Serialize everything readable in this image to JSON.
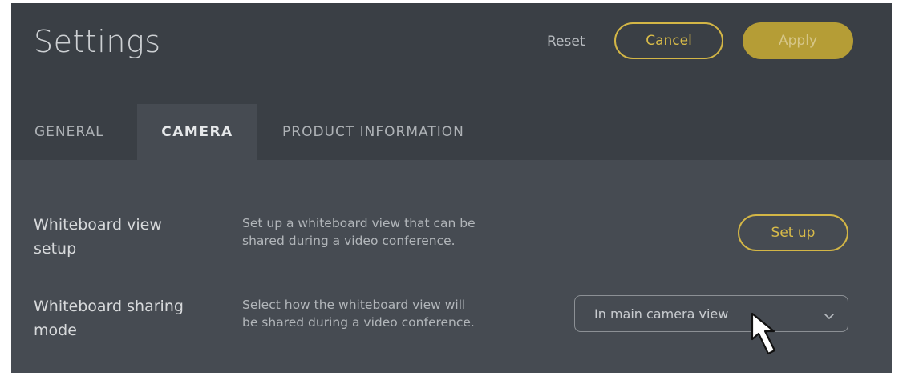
{
  "header": {
    "title": "Settings",
    "reset_label": "Reset",
    "cancel_label": "Cancel",
    "apply_label": "Apply"
  },
  "tabs": [
    {
      "label": "GENERAL",
      "active": false
    },
    {
      "label": "CAMERA",
      "active": true
    },
    {
      "label": "PRODUCT INFORMATION",
      "active": false
    }
  ],
  "settings": {
    "whiteboard_setup": {
      "title_line1": "Whiteboard view",
      "title_line2": "setup",
      "desc_line1": "Set up a whiteboard view that can be",
      "desc_line2": "shared during a video conference.",
      "button_label": "Set up"
    },
    "whiteboard_sharing": {
      "title_line1": "Whiteboard sharing",
      "title_line2": "mode",
      "desc_line1": "Select how the whiteboard view will",
      "desc_line2": "be shared during a video conference.",
      "selected_value": "In main camera view"
    }
  },
  "colors": {
    "header_bg": "#3a3f45",
    "panel_bg": "#464b52",
    "accent": "#d3b646",
    "apply_fill": "#b59d36"
  },
  "icons": [
    "chevron-down-icon",
    "mouse-pointer-icon"
  ]
}
